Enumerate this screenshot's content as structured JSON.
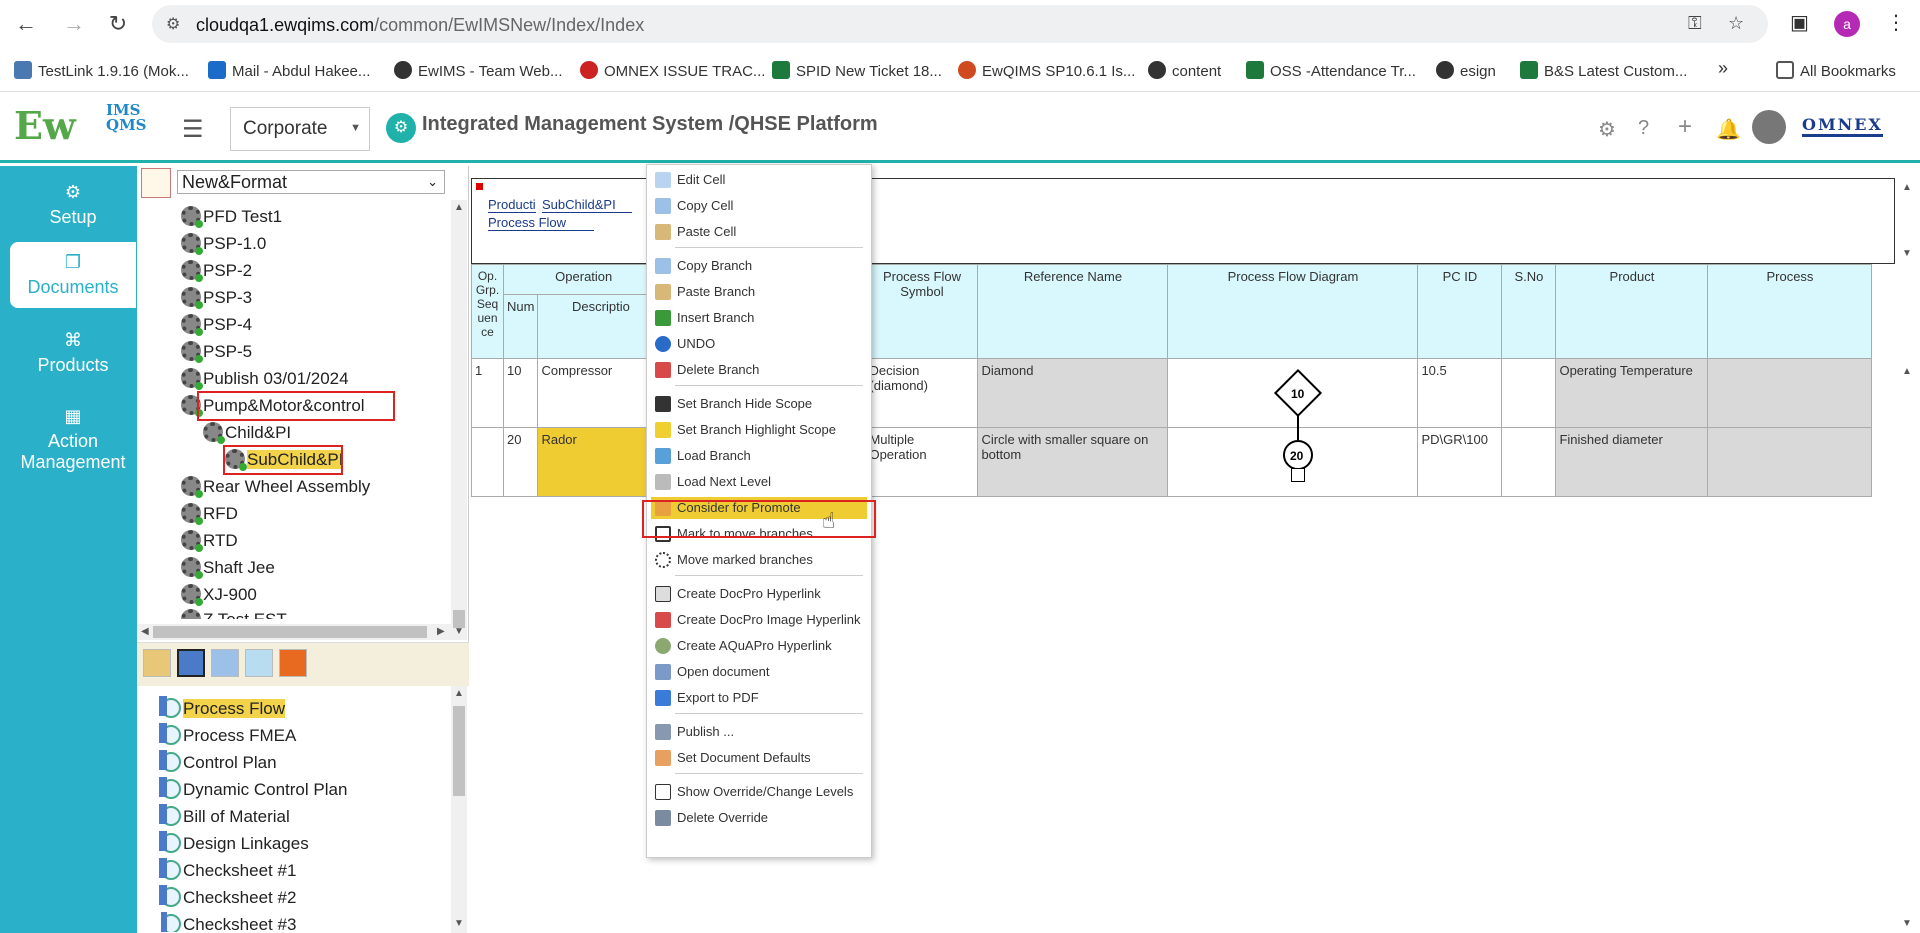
{
  "browser": {
    "url_host": "cloudqa1.ewqims.com",
    "url_path": "/common/EwIMSNew/Index/Index",
    "profile_initial": "a",
    "bookmarks": [
      "TestLink 1.9.16 (Mok...",
      "Mail - Abdul Hakee...",
      "EwIMS - Team Web...",
      "OMNEX ISSUE TRAC...",
      "SPID New Ticket 18...",
      "EwQIMS SP10.6.1 Is...",
      "content",
      "OSS -Attendance Tr...",
      "esign",
      "B&S Latest Custom..."
    ],
    "more_bookmarks": "»",
    "all_bookmarks": "All Bookmarks"
  },
  "app": {
    "logo": "Ew",
    "logo_sub": "IMS QMS",
    "org": "Corporate",
    "title": "Integrated Management System /QHSE Platform",
    "brand": "OMNEX"
  },
  "leftnav": [
    {
      "label": "Setup",
      "icon": "gears-icon"
    },
    {
      "label": "Documents",
      "icon": "copy-icon"
    },
    {
      "label": "Products",
      "icon": "product-icon"
    },
    {
      "label": "Action Management",
      "icon": "building-icon"
    }
  ],
  "tree": {
    "select": "New&Format",
    "items": [
      "PFD Test1",
      "PSP-1.0",
      "PSP-2",
      "PSP-3",
      "PSP-4",
      "PSP-5",
      "Publish 03/01/2024",
      "Pump&Motor&control",
      "Child&PI",
      "SubChild&PI",
      "Rear Wheel Assembly",
      "RFD",
      "RTD",
      "Shaft Jee",
      "XJ-900",
      "Z Test EST"
    ]
  },
  "documents": [
    "Process Flow",
    "Process FMEA",
    "Control Plan",
    "Dynamic Control Plan",
    "Bill of Material",
    "Design Linkages",
    "Checksheet #1",
    "Checksheet #2",
    "Checksheet #3"
  ],
  "header": {
    "tab1": "Producti",
    "tab2": "SubChild&PI",
    "tab3": "Process Flow"
  },
  "grid": {
    "headers": {
      "opgrp": "Op. Grp. Seq uen ce",
      "operation": "Operation",
      "num": "Num",
      "desc": "Descriptio",
      "pfs": "Process Flow Symbol",
      "refname": "Reference Name",
      "pfd": "Process Flow Diagram",
      "pcid": "PC ID",
      "sno": "S.No",
      "product": "Product",
      "process": "Process"
    },
    "rows": [
      {
        "seq": "1",
        "num": "10",
        "desc": "Compressor",
        "symbol": "Decision (diamond)",
        "ref": "Diamond",
        "diagram": "10",
        "pcid": "10.5",
        "sno": "",
        "product": "Operating Temperature",
        "process": ""
      },
      {
        "seq": "",
        "num": "20",
        "desc": "Rador",
        "symbol": "Multiple Operation",
        "ref": "Circle with smaller square on bottom",
        "diagram": "20",
        "pcid": "PD\\GR\\100",
        "sno": "",
        "product": "Finished diameter",
        "process": ""
      }
    ]
  },
  "context_menu": [
    "Edit Cell",
    "Copy Cell",
    "Paste Cell",
    "Copy Branch",
    "Paste Branch",
    "Insert Branch",
    "UNDO",
    "Delete Branch",
    "Set Branch Hide Scope",
    "Set Branch Highlight Scope",
    "Load Branch",
    "Load Next Level",
    "Consider for Promote",
    "Mark to move branches",
    "Move marked branches",
    "Create DocPro Hyperlink",
    "Create DocPro Image Hyperlink",
    "Create AQuAPro Hyperlink",
    "Open document",
    "Export to PDF",
    "Publish ...",
    "Set Document Defaults",
    "Show Override/Change Levels",
    "Delete Override"
  ]
}
